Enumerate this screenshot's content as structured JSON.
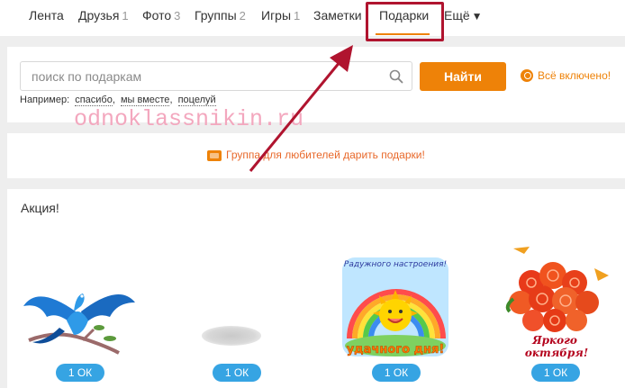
{
  "nav": {
    "items": [
      {
        "label": "Лента",
        "count": ""
      },
      {
        "label": "Друзья",
        "count": "1"
      },
      {
        "label": "Фото",
        "count": "3"
      },
      {
        "label": "Группы",
        "count": "2"
      },
      {
        "label": "Игры",
        "count": "1"
      },
      {
        "label": "Заметки",
        "count": ""
      },
      {
        "label": "Подарки",
        "count": ""
      },
      {
        "label": "Ещё",
        "count": ""
      }
    ],
    "active": "Подарки",
    "more_caret": "▼"
  },
  "search": {
    "placeholder": "поиск по подаркам",
    "value": "",
    "button_label": "Найти",
    "included_label": "Всё включено!",
    "example_prefix": "Например:",
    "examples": [
      "спасибо",
      "мы вместе",
      "поцелуй"
    ]
  },
  "watermark": "odnoklassnikin.ru",
  "group_banner": "Группа для любителей дарить подарки!",
  "promo": {
    "title": "Акция!",
    "gifts": [
      {
        "name": "blue-bird",
        "price": "1 ОК"
      },
      {
        "name": "loading-placeholder",
        "price": "1 ОК"
      },
      {
        "name": "sun-rainbow",
        "price": "1 ОК",
        "caption_top": "Радужного настроения!",
        "caption_bottom": "удачного дня!"
      },
      {
        "name": "roses-bouquet",
        "price": "1 ОК",
        "caption_top": "Яркого",
        "caption_bottom": "октября!"
      }
    ]
  },
  "colors": {
    "accent_orange": "#ee8208",
    "price_blue": "#36a4e3",
    "highlight_red": "#b0142f",
    "watermark_pink": "#f3a7be"
  }
}
